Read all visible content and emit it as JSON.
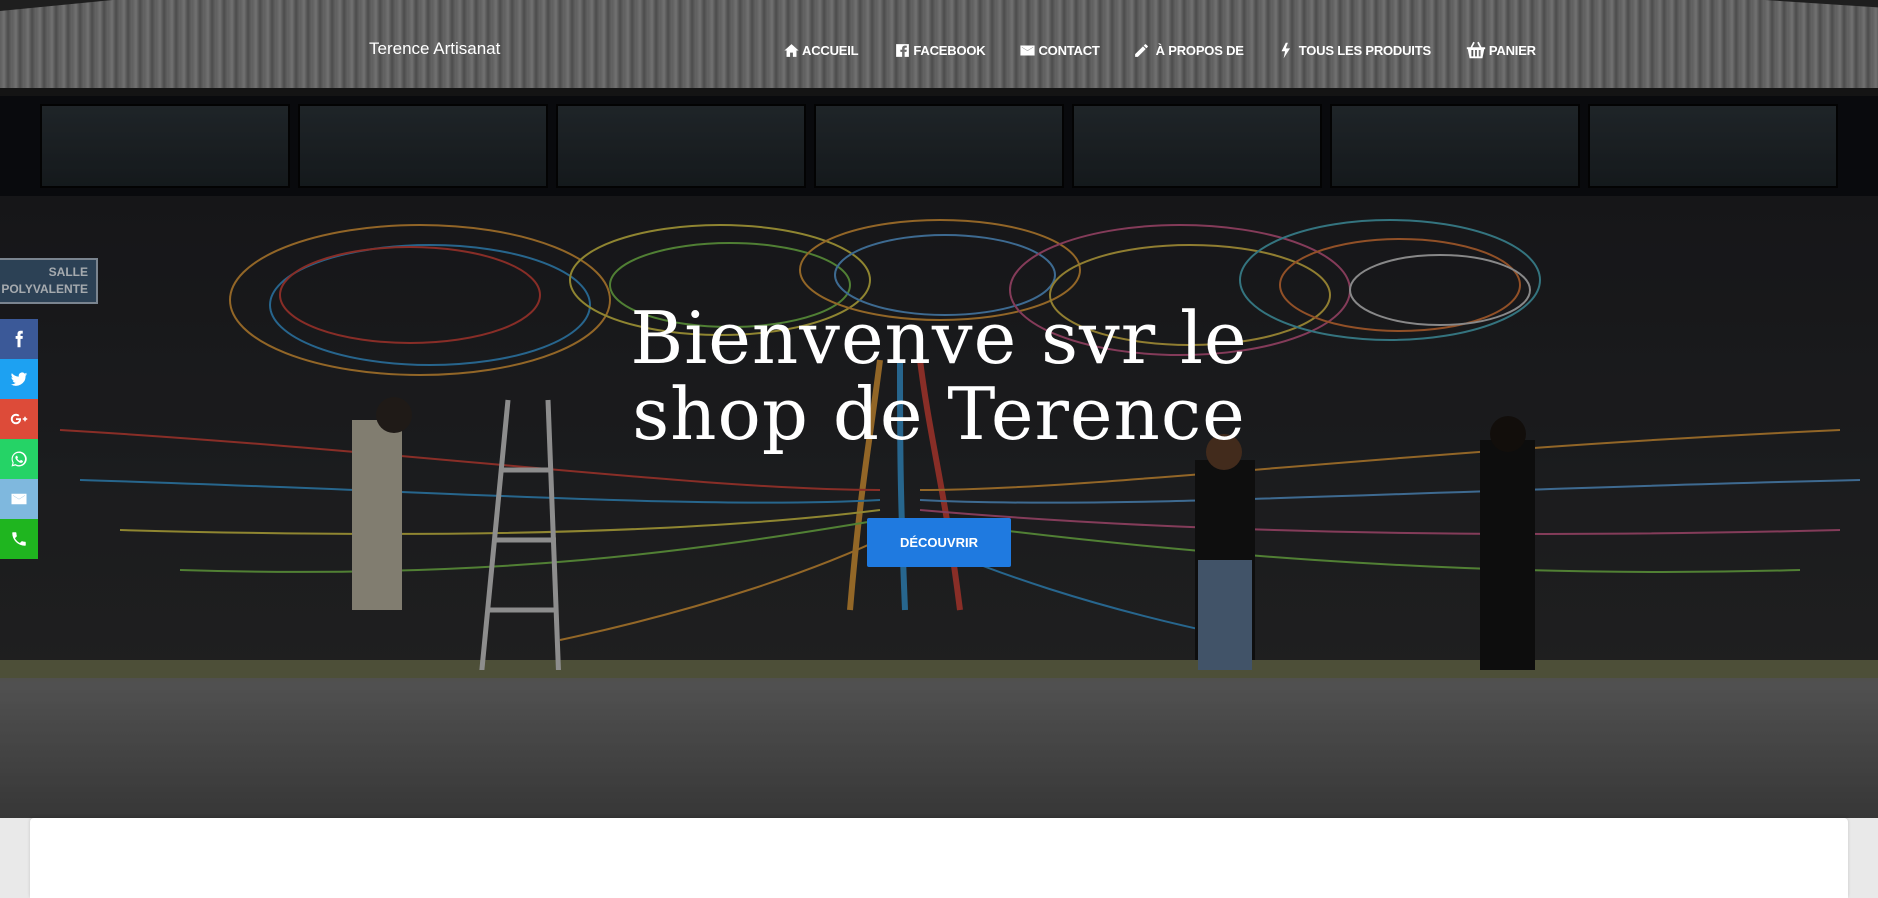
{
  "nav": {
    "brand": "Terence Artisanat",
    "items": [
      {
        "label": "ACCUEIL",
        "icon": "home-icon"
      },
      {
        "label": "FACEBOOK",
        "icon": "facebook-icon"
      },
      {
        "label": "CONTACT",
        "icon": "mail-icon"
      },
      {
        "label": "À PROPOS DE",
        "icon": "pencil-icon"
      },
      {
        "label": "TOUS LES PRODUITS",
        "icon": "bolt-icon"
      },
      {
        "label": "PANIER",
        "icon": "basket-icon"
      }
    ]
  },
  "hero": {
    "title_line1": "Bienvenve svr le",
    "title_line2": "shop de Terence",
    "cta_label": "DÉCOUVRIR",
    "sign_line1": "SALLE",
    "sign_line2": "POLYVALENTE"
  },
  "social": [
    {
      "name": "facebook-share-icon",
      "color": "#3b5998"
    },
    {
      "name": "twitter-share-icon",
      "color": "#1da1f2"
    },
    {
      "name": "google-plus-share-icon",
      "color": "#dd4b39"
    },
    {
      "name": "whatsapp-share-icon",
      "color": "#25d366"
    },
    {
      "name": "email-share-icon",
      "color": "#7fb8de"
    },
    {
      "name": "phone-share-icon",
      "color": "#1fb51f"
    }
  ],
  "colors": {
    "accent": "#1f7ae0",
    "card": "#ffffff"
  }
}
